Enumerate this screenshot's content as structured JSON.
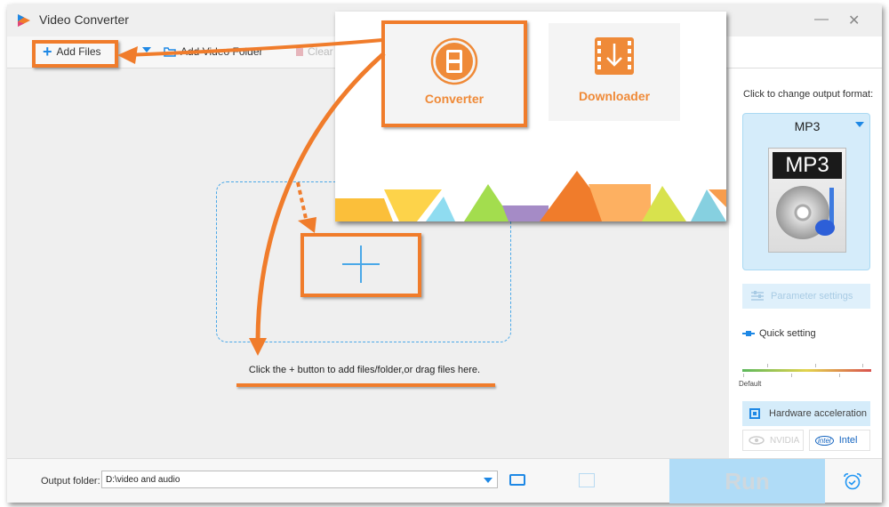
{
  "window": {
    "title": "Video Converter",
    "minimize_glyph": "—",
    "close_glyph": "✕"
  },
  "toolbar": {
    "add_files": "Add Files",
    "add_video_folder": "Add Video Folder",
    "clear": "Clear"
  },
  "modes": {
    "converter": "Converter",
    "downloader": "Downloader"
  },
  "main": {
    "hint": "Click the + button to add files/folder,or drag files here."
  },
  "right_panel": {
    "format_prompt": "Click to change output format:",
    "format_name": "MP3",
    "format_icon_label": "MP3",
    "parameter_settings": "Parameter settings",
    "quick_setting": "Quick setting",
    "quality_level": 0,
    "default_label": "Default",
    "hardware_acceleration": "Hardware acceleration",
    "nvidia": "NVIDIA",
    "intel_logo": "intel",
    "intel": "Intel"
  },
  "bottom": {
    "output_folder_label": "Output folder:",
    "output_folder_value": "D:\\video and audio",
    "run": "Run"
  },
  "colors": {
    "accent_blue": "#1e88e5",
    "annotation_orange": "#f07c2b",
    "format_bg": "#d5ecfa",
    "run_bg": "#b0dcf7"
  }
}
